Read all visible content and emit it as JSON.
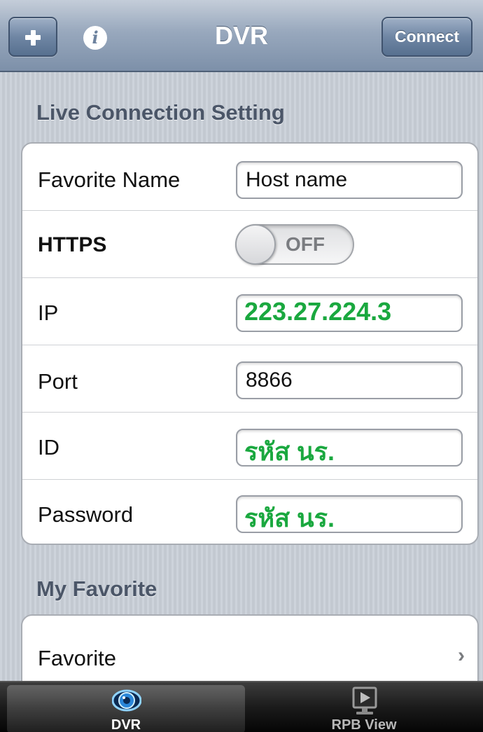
{
  "navbar": {
    "title": "DVR",
    "add_icon": "plus-icon",
    "info_icon": "info-icon",
    "info_glyph": "i",
    "connect_label": "Connect"
  },
  "live_section": {
    "header": "Live Connection Setting",
    "rows": [
      {
        "label": "Favorite Name",
        "value": "Host name"
      },
      {
        "label": "HTTPS",
        "toggle": "OFF"
      },
      {
        "label": "IP",
        "value": "223.27.224.3"
      },
      {
        "label": "Port",
        "value": "8866"
      },
      {
        "label": "ID",
        "value": "รหัส นร."
      },
      {
        "label": "Password",
        "value": "รหัส นร."
      }
    ]
  },
  "favorite_section": {
    "header": "My Favorite",
    "row_label": "Favorite",
    "chevron": "›"
  },
  "tabbar": {
    "tabs": [
      {
        "label": "DVR",
        "icon": "eye-icon",
        "active": true
      },
      {
        "label": "RPB View",
        "icon": "playback-icon",
        "active": false
      }
    ]
  },
  "colors": {
    "accent_overlay": "#1aa83f",
    "navbar": "#8a9db5"
  }
}
